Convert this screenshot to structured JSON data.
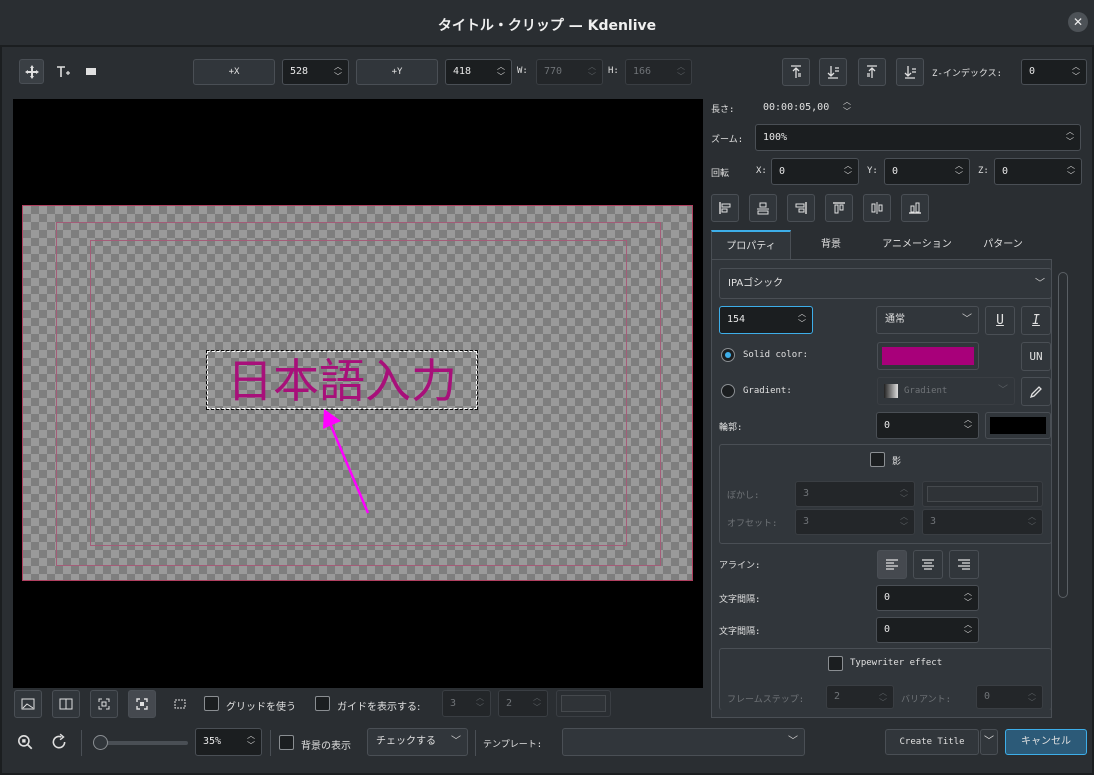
{
  "window": {
    "title": "タイトル・クリップ — Kdenlive",
    "close": "✕"
  },
  "toolbar": {
    "x_button": "+X",
    "x_value": "528",
    "y_button": "+Y",
    "y_value": "418",
    "w_label": "W:",
    "w_value": "770",
    "h_label": "H:",
    "h_value": "166",
    "z_label": "Z-インデックス:",
    "z_value": "0"
  },
  "right": {
    "length_label": "長さ:",
    "length_value": "00:00:05,00",
    "zoom_label": "ズーム:",
    "zoom_value": "100%",
    "rotate_label": "回転",
    "rx_label": "X:",
    "rx_value": "0",
    "ry_label": "Y:",
    "ry_value": "0",
    "rz_label": "Z:",
    "rz_value": "0"
  },
  "tabs": [
    "プロパティ",
    "背景",
    "アニメーション",
    "パターン"
  ],
  "properties": {
    "font": "IPAゴシック",
    "size": "154",
    "weight": "通常",
    "underline_btn": "U",
    "italic_btn": "I",
    "uppercase_btn": "UN",
    "solid_label": "Solid color:",
    "solid_color": "#a8007a",
    "gradient_label": "Gradient:",
    "gradient_value": "Gradient",
    "outline_label": "輪郭:",
    "outline_value": "0",
    "shadow_label": "影",
    "blur_label": "ぼかし:",
    "blur_value": "3",
    "offset_label": "オフセット:",
    "offset_x": "3",
    "offset_y": "3",
    "align_label": "アライン:",
    "spacing1_label": "文字間隔:",
    "spacing1_value": "0",
    "spacing2_label": "文字間隔:",
    "spacing2_value": "0",
    "typewriter_label": "Typewriter effect",
    "frame_step_label": "フレームステップ:",
    "frame_step_value": "2",
    "variant_label": "バリアント:",
    "variant_value": "0"
  },
  "canvas": {
    "text": "日本語入力"
  },
  "bottom_bar": {
    "grid_label": "グリッドを使う",
    "guides_label": "ガイドを表示する:",
    "guides_h": "3",
    "guides_v": "2",
    "zoom_value": "35%",
    "bg_label": "背景の表示",
    "bg_select": "チェックする",
    "template_label": "テンプレート:",
    "template_value": "",
    "create_button": "Create Title",
    "cancel_button": "キャンセル"
  },
  "colors": {
    "accent": "#3daee9",
    "text_color": "#a8107a",
    "annotation_arrow": "#ff00ff"
  }
}
